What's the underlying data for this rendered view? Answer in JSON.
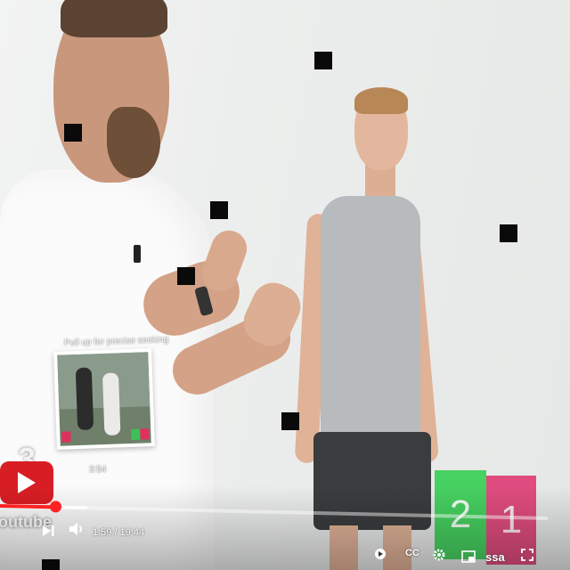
{
  "player": {
    "preview": {
      "caption": "Pull up for precise seeking",
      "time": "3:54"
    },
    "time": {
      "current": "1:59",
      "separator": " / ",
      "duration": "19:44"
    },
    "progress_fraction": 0.1,
    "buffered_fraction": 0.16,
    "scores": {
      "green": "2",
      "pink": "1"
    },
    "brand": {
      "number": "3",
      "name": "outube"
    },
    "controls": {
      "next_icon": "next-icon",
      "volume_icon": "volume-icon",
      "autoplay_icon": "autoplay-toggle-icon",
      "cc_label": "CC",
      "settings_icon": "gear-icon",
      "miniplayer_icon": "miniplayer-icon",
      "pip_label": "ssa",
      "fullscreen_icon": "fullscreen-icon"
    },
    "colors": {
      "accent": "#ff2222",
      "score_green": "#3fd05a",
      "score_pink": "#e0447a"
    }
  }
}
